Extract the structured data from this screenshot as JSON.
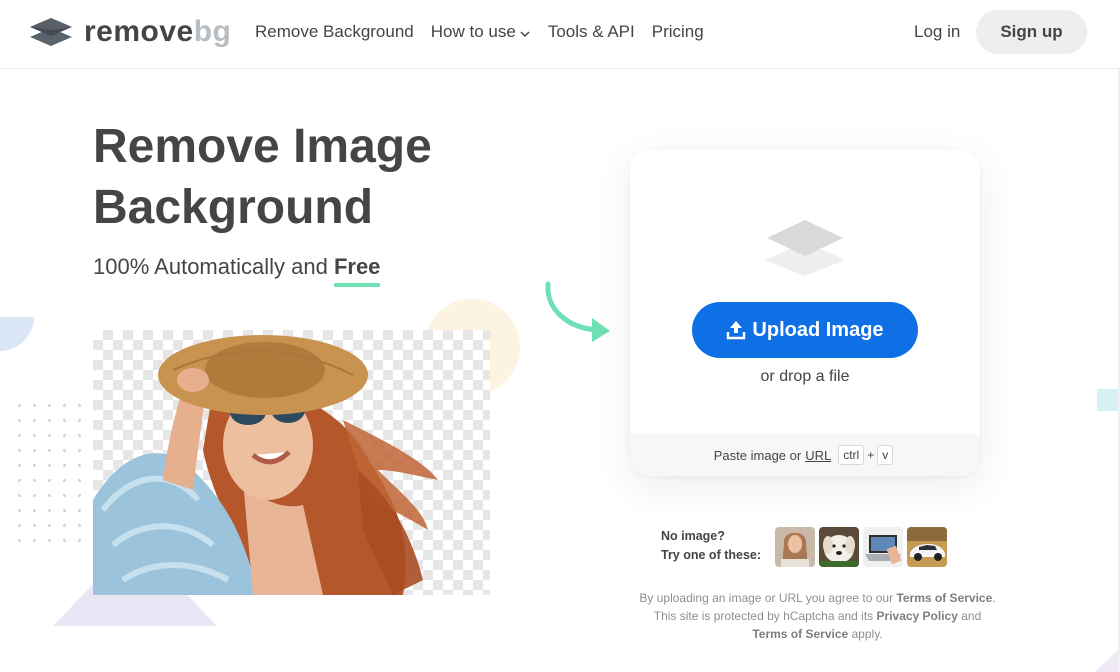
{
  "header": {
    "logo": {
      "text_remove": "remove",
      "text_bg": "bg"
    },
    "nav": [
      {
        "label": "Remove Background"
      },
      {
        "label": "How to use"
      },
      {
        "label": "Tools & API"
      },
      {
        "label": "Pricing"
      }
    ],
    "login_label": "Log in",
    "signup_label": "Sign up"
  },
  "hero": {
    "title_line1": "Remove Image",
    "title_line2": "Background",
    "subtitle_prefix": "100% Automatically and ",
    "subtitle_emphasis": "Free"
  },
  "upload": {
    "button_label": "Upload Image",
    "drop_text": "or drop a file",
    "paste_prefix": "Paste image or",
    "paste_url": "URL",
    "key_ctrl": "ctrl",
    "key_plus": "+",
    "key_v": "v"
  },
  "samples": {
    "line1": "No image?",
    "line2": "Try one of these:",
    "thumbnails": [
      "woman",
      "dog",
      "laptop",
      "car"
    ]
  },
  "legal": {
    "t1": "By uploading an image or URL you agree to our ",
    "terms": "Terms of Service",
    "t2": ".",
    "t3": "This site is protected by hCaptcha and its ",
    "privacy": "Privacy Policy",
    "t4": " and",
    "terms2": "Terms of Service",
    "t5": " apply."
  },
  "colors": {
    "accent": "#0f70e6",
    "free_underline": "#6fe0b4",
    "arrow": "#6fe0b4",
    "text": "#454545"
  },
  "icons": [
    "removebg-logo-icon",
    "chevron-down-icon",
    "layers-icon",
    "upload-icon",
    "curved-arrow-icon"
  ]
}
